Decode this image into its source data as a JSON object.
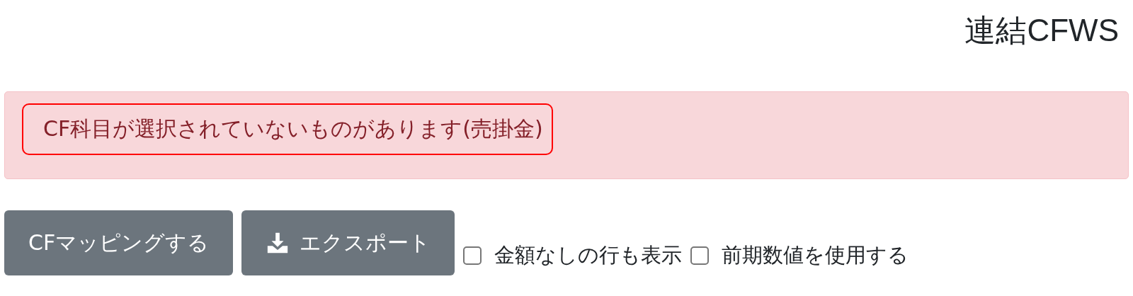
{
  "page": {
    "title": "連結CFWS"
  },
  "alert": {
    "message": "CF科目が選択されていないものがあります(売掛金)"
  },
  "buttons": [
    {
      "kind": "plain",
      "label": "CFマッピングする"
    },
    {
      "kind": "download",
      "label": "エクスポート"
    }
  ],
  "options": [
    {
      "label": "金額なしの行も表示",
      "checked": false
    },
    {
      "label": "前期数値を使用する",
      "checked": false
    }
  ]
}
